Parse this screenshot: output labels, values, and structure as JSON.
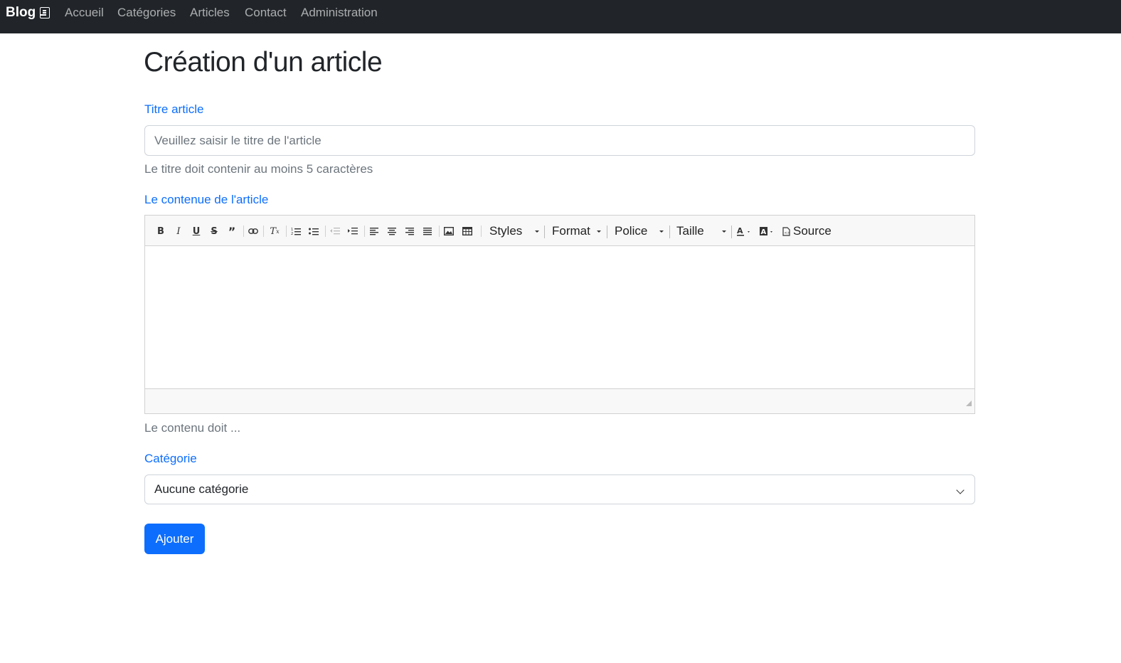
{
  "navbar": {
    "brand": "Blog",
    "links": [
      "Accueil",
      "Catégories",
      "Articles",
      "Contact",
      "Administration"
    ]
  },
  "page": {
    "title": "Création d'un article"
  },
  "form": {
    "title_label": "Titre article",
    "title_placeholder": "Veuillez saisir le titre de l'article",
    "title_help": "Le titre doit contenir au moins 5 caractères",
    "content_label": "Le contenue de l'article",
    "content_help": "Le contenu doit ...",
    "category_label": "Catégorie",
    "category_selected": "Aucune catégorie",
    "submit_label": "Ajouter"
  },
  "editor": {
    "toolbar_buttons": [
      "bold",
      "italic",
      "underline",
      "strikethrough",
      "blockquote",
      "link",
      "remove-format",
      "numbered-list",
      "bulleted-list",
      "outdent",
      "indent",
      "align-left",
      "align-center",
      "align-right",
      "justify",
      "image",
      "table"
    ],
    "combos": [
      "Styles",
      "Format",
      "Police",
      "Taille"
    ],
    "source_label": "Source"
  },
  "colors": {
    "navbar_bg": "#212529",
    "accent": "#0d6efd",
    "muted": "#6c757d"
  }
}
